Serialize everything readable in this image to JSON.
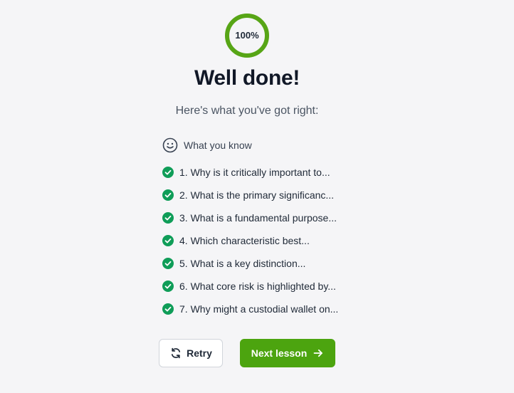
{
  "progress": {
    "value_text": "100%",
    "value": 1.0,
    "color": "#57a516"
  },
  "heading": "Well done!",
  "subheading": "Here's what you've got right:",
  "section": {
    "icon": "smiley-icon",
    "label": "What you know"
  },
  "items": [
    {
      "text": "1. Why is it critically important to...",
      "icon": "check-circle-icon"
    },
    {
      "text": "2. What is the primary significanc...",
      "icon": "check-circle-icon"
    },
    {
      "text": "3. What is a fundamental purpose...",
      "icon": "check-circle-icon"
    },
    {
      "text": "4. Which characteristic best...",
      "icon": "check-circle-icon"
    },
    {
      "text": "5. What is a key distinction...",
      "icon": "check-circle-icon"
    },
    {
      "text": "6. What core risk is highlighted by...",
      "icon": "check-circle-icon"
    },
    {
      "text": "7. Why might a custodial wallet on...",
      "icon": "check-circle-icon"
    }
  ],
  "actions": {
    "retry_label": "Retry",
    "retry_icon": "refresh-icon",
    "next_label": "Next lesson",
    "next_icon": "arrow-right-icon"
  },
  "colors": {
    "accent": "#4ca40f",
    "check": "#0f9d58",
    "background": "#f5f5f7"
  }
}
